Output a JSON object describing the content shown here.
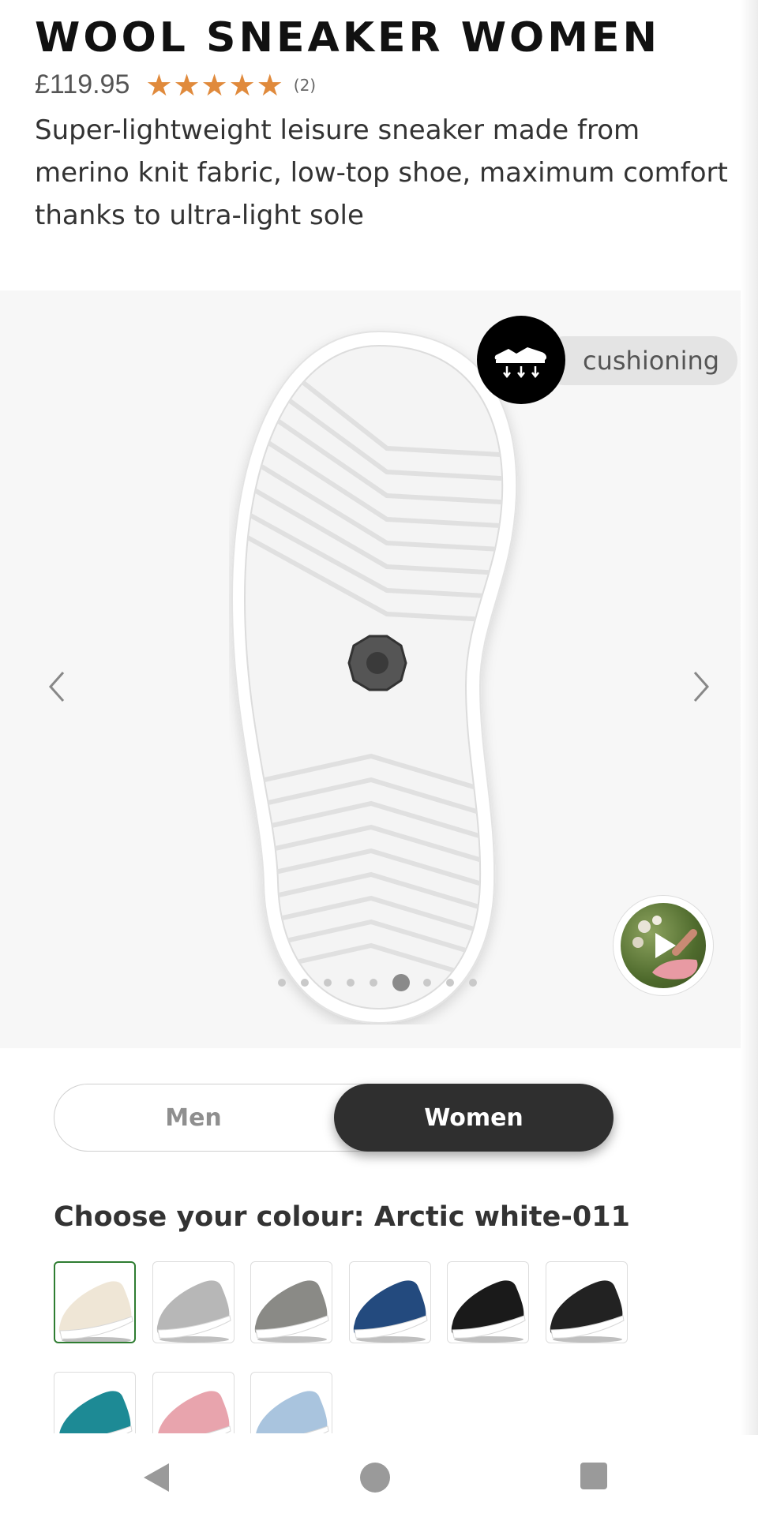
{
  "product": {
    "title": "WOOL SNEAKER WOMEN",
    "price": "£119.95",
    "rating": 5,
    "rating_max": 5,
    "review_count": "(2)",
    "description": "Super-lightweight leisure sneaker made from merino knit fabric, low-top shoe, maximum comfort thanks to ultra-light sole"
  },
  "gallery": {
    "feature_label": "cushioning",
    "feature_icon": "cushioning-shoe-icon",
    "image_count": 9,
    "active_index": 5,
    "prev_icon": "chevron-left-icon",
    "next_icon": "chevron-right-icon",
    "video_icon": "play-icon"
  },
  "gender": {
    "options": [
      "Men",
      "Women"
    ],
    "selected": "Women"
  },
  "colour": {
    "heading": "Choose your colour: Arctic white-011",
    "swatches": [
      {
        "color": "#efe6d6",
        "selected": true
      },
      {
        "color": "#b7b7b7",
        "selected": false
      },
      {
        "color": "#8a8a86",
        "selected": false
      },
      {
        "color": "#234a7e",
        "selected": false
      },
      {
        "color": "#1a1a1a",
        "selected": false
      },
      {
        "color": "#222222",
        "selected": false
      },
      {
        "color": "#1d8a95",
        "selected": false
      },
      {
        "color": "#e8a4ad",
        "selected": false
      },
      {
        "color": "#a9c4de",
        "selected": false
      }
    ]
  },
  "navbar": {
    "back_icon": "back-triangle-icon",
    "home_icon": "home-circle-icon",
    "recents_icon": "recents-square-icon"
  }
}
